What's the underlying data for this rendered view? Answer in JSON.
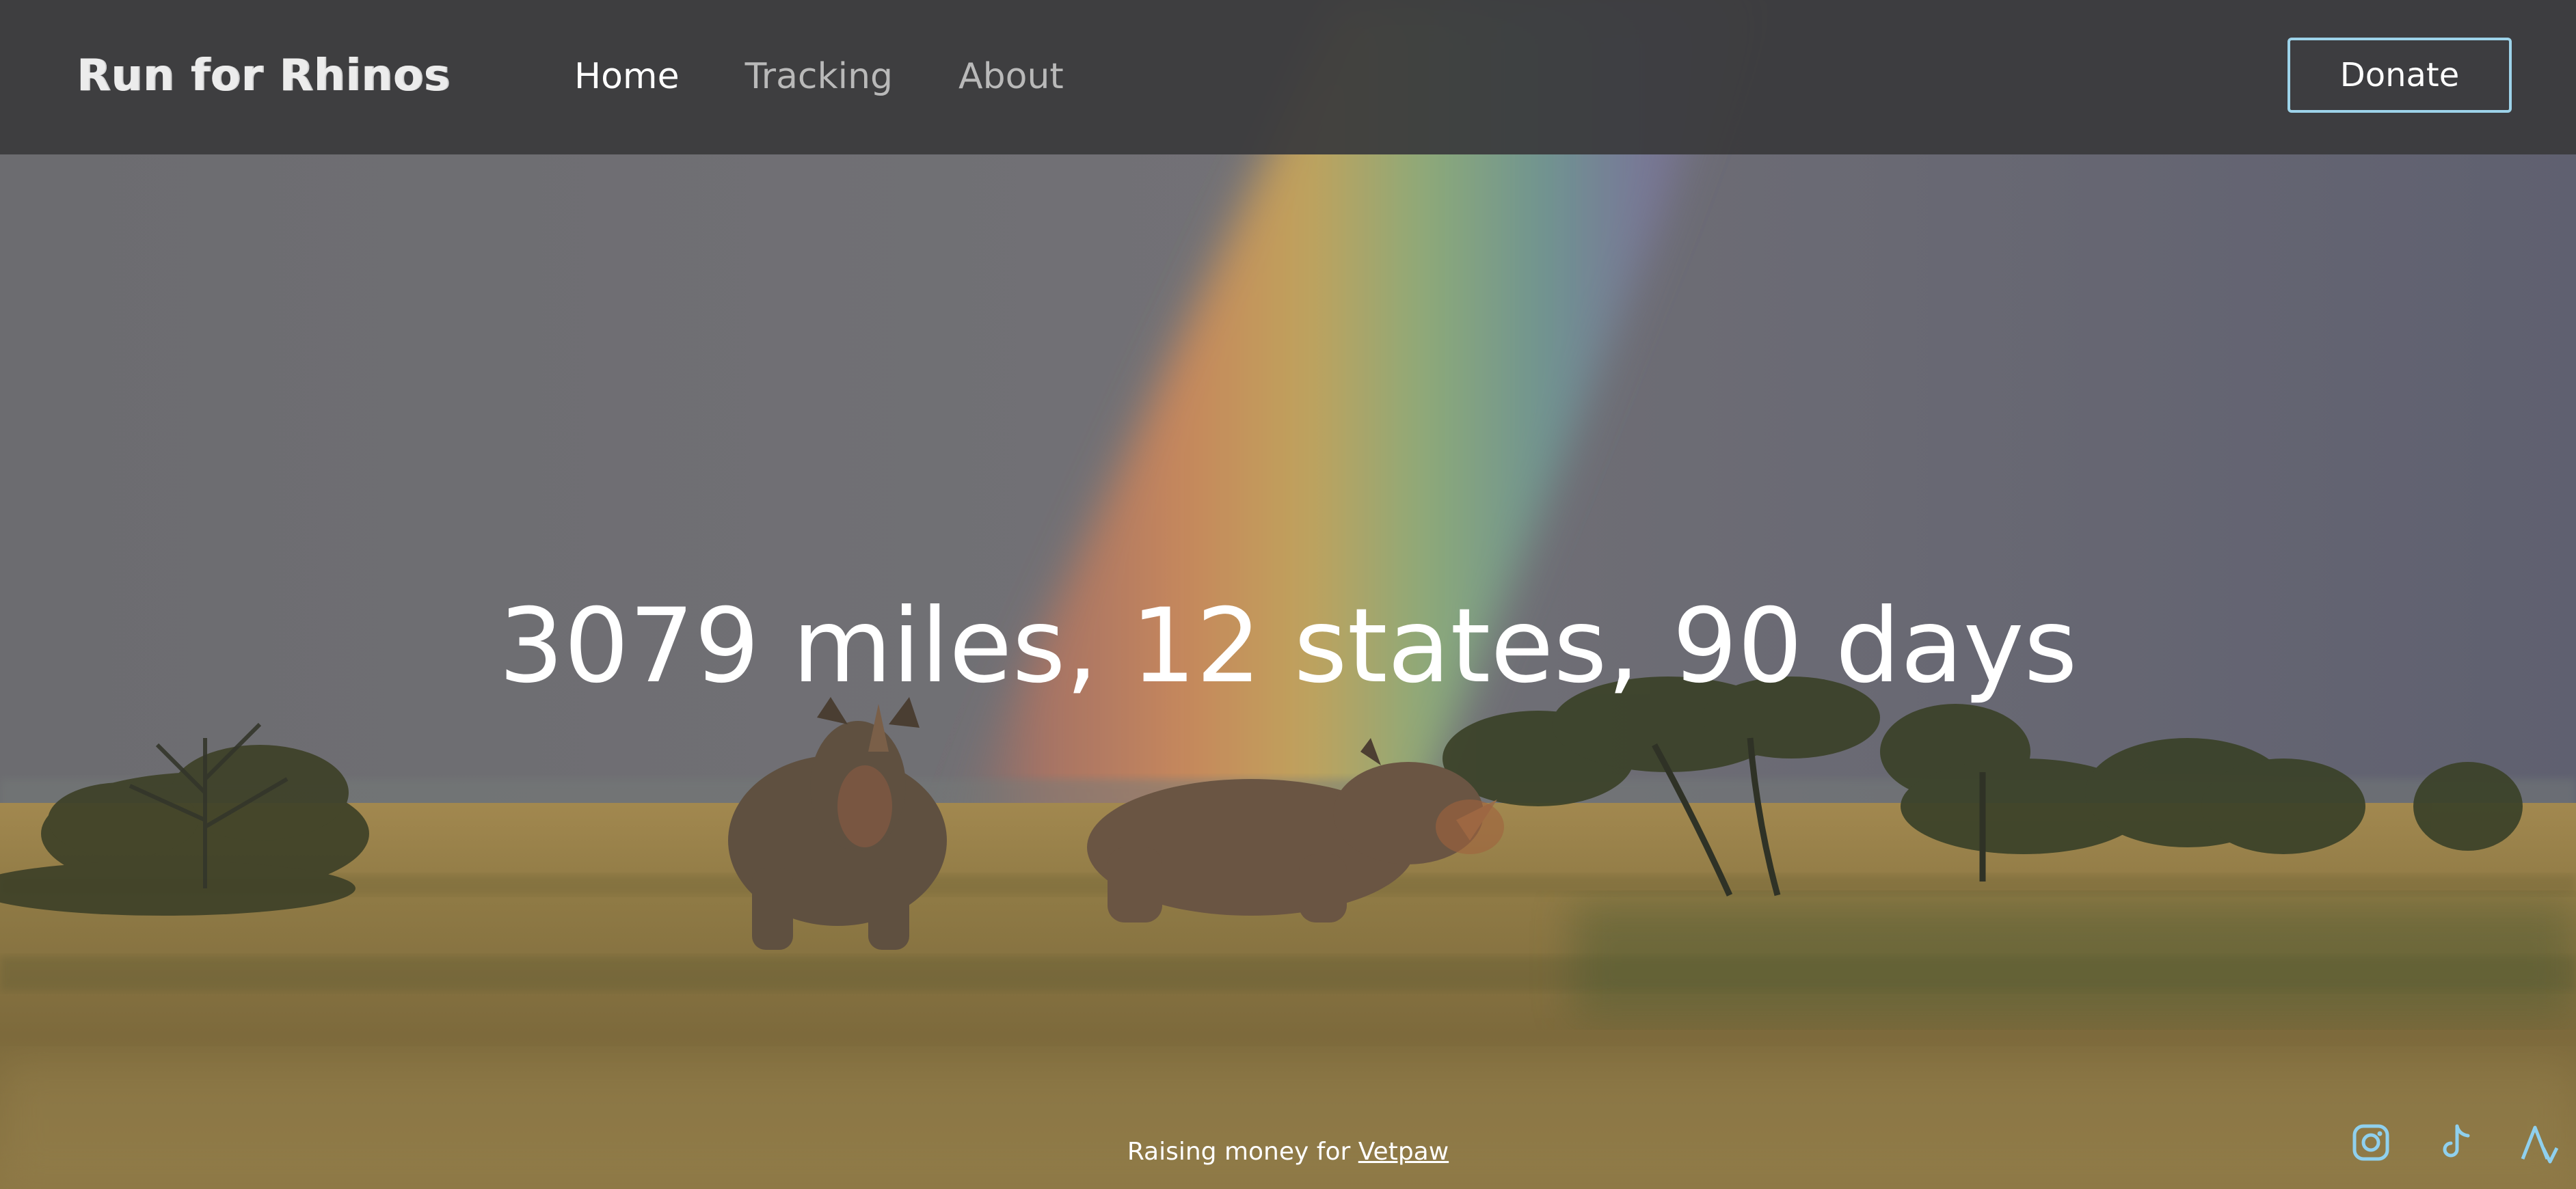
{
  "header": {
    "brand": "Run for Rhinos",
    "nav": [
      {
        "label": "Home",
        "active": true
      },
      {
        "label": "Tracking",
        "active": false
      },
      {
        "label": "About",
        "active": false
      }
    ],
    "donate_label": "Donate"
  },
  "hero": {
    "headline": "3079 miles, 12 states, 90 days",
    "background": "hero-photo-rhinos-rainbow"
  },
  "footer": {
    "text_prefix": "Raising money for ",
    "link_text": "Vetpaw",
    "social_icons": [
      "instagram-icon",
      "tiktok-icon",
      "strava-icon"
    ]
  },
  "colors": {
    "accent": "#9dd3ea",
    "topbar": "#3a3a3c",
    "text": "#ffffff",
    "nav_inactive": "#b9b9b9"
  }
}
